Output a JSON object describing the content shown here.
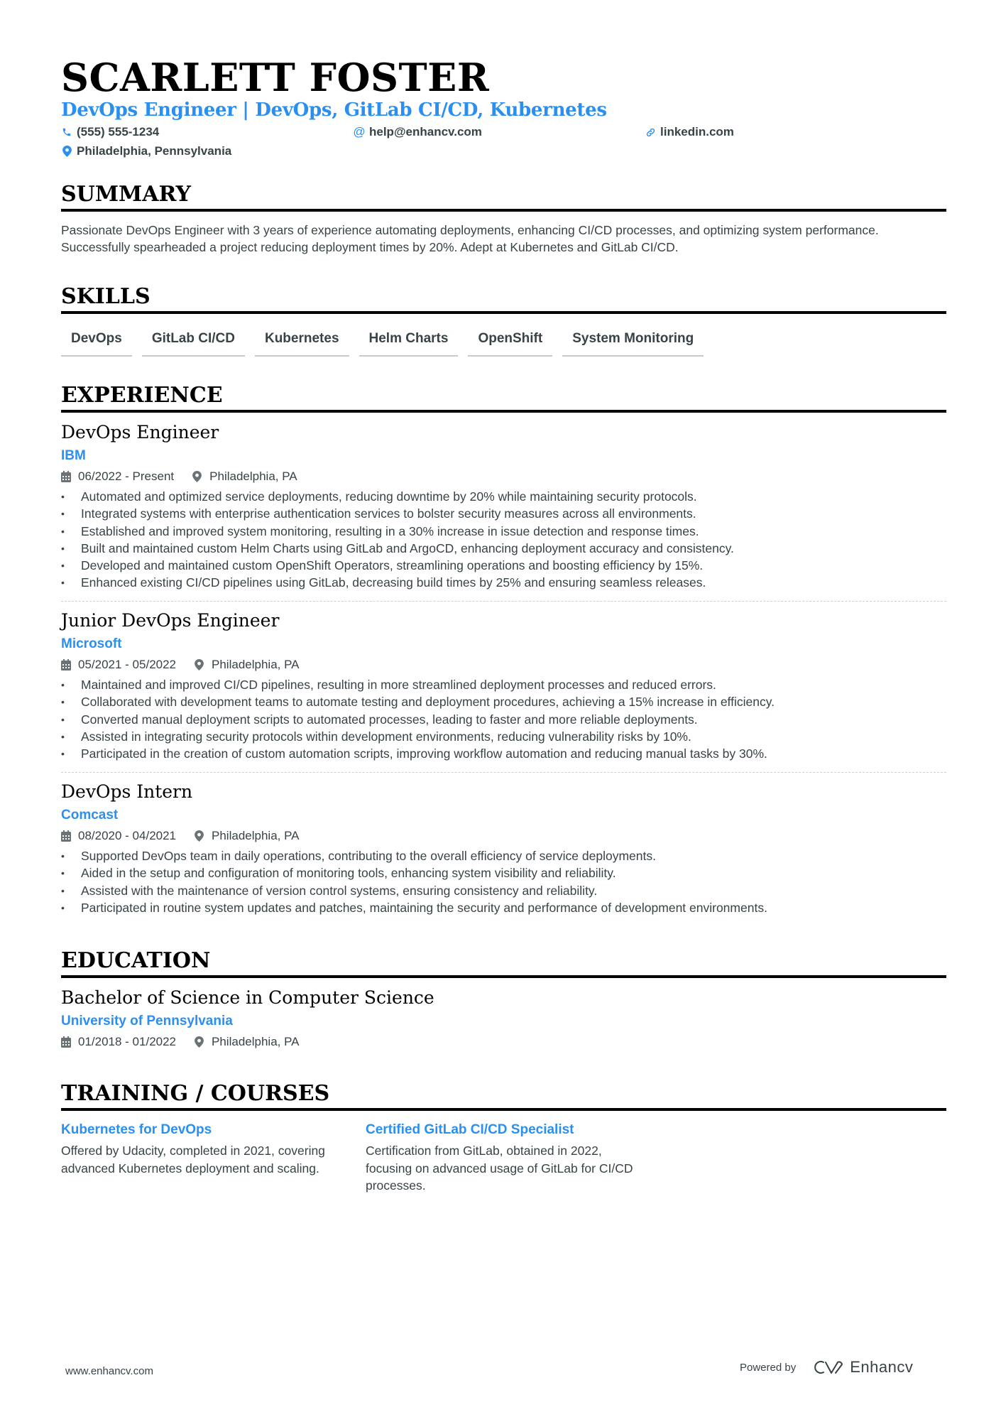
{
  "header": {
    "name": "SCARLETT FOSTER",
    "headline": "DevOps Engineer | DevOps, GitLab CI/CD, Kubernetes",
    "phone": "(555) 555-1234",
    "email": "help@enhancv.com",
    "link": "linkedin.com",
    "location": "Philadelphia, Pennsylvania",
    "icons": {
      "phone": "phone-icon",
      "email": "at-icon",
      "link": "link-icon",
      "location": "map-pin-icon"
    }
  },
  "summary": {
    "title": "SUMMARY",
    "text": "Passionate DevOps Engineer with 3 years of experience automating deployments, enhancing CI/CD processes, and optimizing system performance. Successfully spearheaded a project reducing deployment times by 20%. Adept at Kubernetes and GitLab CI/CD."
  },
  "skills": {
    "title": "SKILLS",
    "items": [
      "DevOps",
      "GitLab CI/CD",
      "Kubernetes",
      "Helm Charts",
      "OpenShift",
      "System Monitoring"
    ]
  },
  "experience": {
    "title": "EXPERIENCE",
    "jobs": [
      {
        "title": "DevOps Engineer",
        "company": "IBM",
        "dates": "06/2022 - Present",
        "location": "Philadelphia, PA",
        "bullets": [
          "Automated and optimized service deployments, reducing downtime by 20% while maintaining security protocols.",
          "Integrated systems with enterprise authentication services to bolster security measures across all environments.",
          "Established and improved system monitoring, resulting in a 30% increase in issue detection and response times.",
          "Built and maintained custom Helm Charts using GitLab and ArgoCD, enhancing deployment accuracy and consistency.",
          "Developed and maintained custom OpenShift Operators, streamlining operations and boosting efficiency by 15%.",
          "Enhanced existing CI/CD pipelines using GitLab, decreasing build times by 25% and ensuring seamless releases."
        ]
      },
      {
        "title": "Junior DevOps Engineer",
        "company": "Microsoft",
        "dates": "05/2021 - 05/2022",
        "location": "Philadelphia, PA",
        "bullets": [
          "Maintained and improved CI/CD pipelines, resulting in more streamlined deployment processes and reduced errors.",
          "Collaborated with development teams to automate testing and deployment procedures, achieving a 15% increase in efficiency.",
          "Converted manual deployment scripts to automated processes, leading to faster and more reliable deployments.",
          "Assisted in integrating security protocols within development environments, reducing vulnerability risks by 10%.",
          "Participated in the creation of custom automation scripts, improving workflow automation and reducing manual tasks by 30%."
        ]
      },
      {
        "title": "DevOps Intern",
        "company": "Comcast",
        "dates": "08/2020 - 04/2021",
        "location": "Philadelphia, PA",
        "bullets": [
          "Supported DevOps team in daily operations, contributing to the overall efficiency of service deployments.",
          "Aided in the setup and configuration of monitoring tools, enhancing system visibility and reliability.",
          "Assisted with the maintenance of version control systems, ensuring consistency and reliability.",
          "Participated in routine system updates and patches, maintaining the security and performance of development environments."
        ]
      }
    ]
  },
  "education": {
    "title": "EDUCATION",
    "degree": "Bachelor of Science in Computer Science",
    "school": "University of Pennsylvania",
    "dates": "01/2018 - 01/2022",
    "location": "Philadelphia, PA"
  },
  "training": {
    "title": "TRAINING / COURSES",
    "items": [
      {
        "title": "Kubernetes for DevOps",
        "description": "Offered by Udacity, completed in 2021, covering advanced Kubernetes deployment and scaling."
      },
      {
        "title": "Certified GitLab CI/CD Specialist",
        "description": "Certification from GitLab, obtained in 2022, focusing on advanced usage of GitLab for CI/CD processes."
      }
    ]
  },
  "footer": {
    "website": "www.enhancv.com",
    "powered_by": "Powered by",
    "brand": "Enhancv"
  },
  "colors": {
    "accent": "#2B8FF0",
    "text": "#384347",
    "heading": "#000000"
  }
}
